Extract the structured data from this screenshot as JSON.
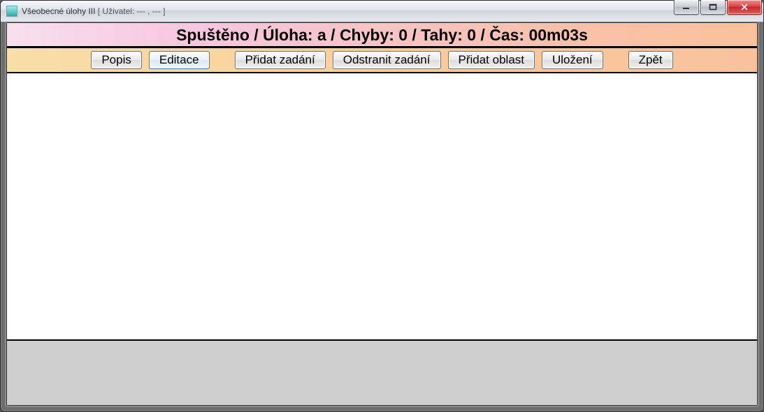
{
  "window": {
    "title_main": "Všeobecné úlohy III",
    "title_suffix": " [ Uživatel: --- , --- ]"
  },
  "status": {
    "text": "Spuštěno / Úloha: a / Chyby: 0 / Tahy: 0 / Čas: 00m03s"
  },
  "toolbar": {
    "popis": "Popis",
    "editace": "Editace",
    "pridat_zadani": "Přidat zadání",
    "odstranit_zadani": "Odstranit zadání",
    "pridat_oblast": "Přidat oblast",
    "ulozeni": "Uložení",
    "zpet": "Zpět"
  }
}
